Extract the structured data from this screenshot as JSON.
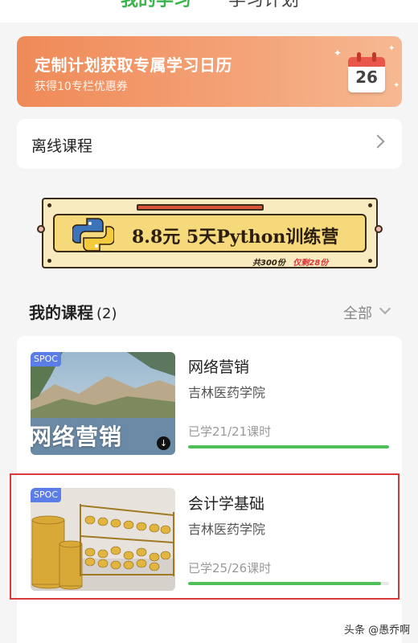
{
  "tabs": {
    "active": "我的学习",
    "inactive": "学习计划"
  },
  "promo": {
    "title": "定制计划获取专属学习日历",
    "subtitle": "获得10专栏优惠券",
    "calendar_day": "26"
  },
  "offline": {
    "label": "离线课程"
  },
  "ad": {
    "headline": "8.8元 5天Python训练营",
    "footer_total": "共300份",
    "footer_remaining": "仅剩28份"
  },
  "courses_section": {
    "title": "我的课程",
    "count": "(2)",
    "filter_label": "全部"
  },
  "courses": [
    {
      "badge": "SPOC",
      "title": "网络营销",
      "thumb_text": "网络营销",
      "school": "吉林医药学院",
      "progress_text": "已学21/21课时",
      "progress": 1.0
    },
    {
      "badge": "SPOC",
      "title": "会计学基础",
      "school": "吉林医药学院",
      "progress_text": "已学25/26课时",
      "progress": 0.96
    }
  ],
  "watermark": "头条 @愚乔啊"
}
